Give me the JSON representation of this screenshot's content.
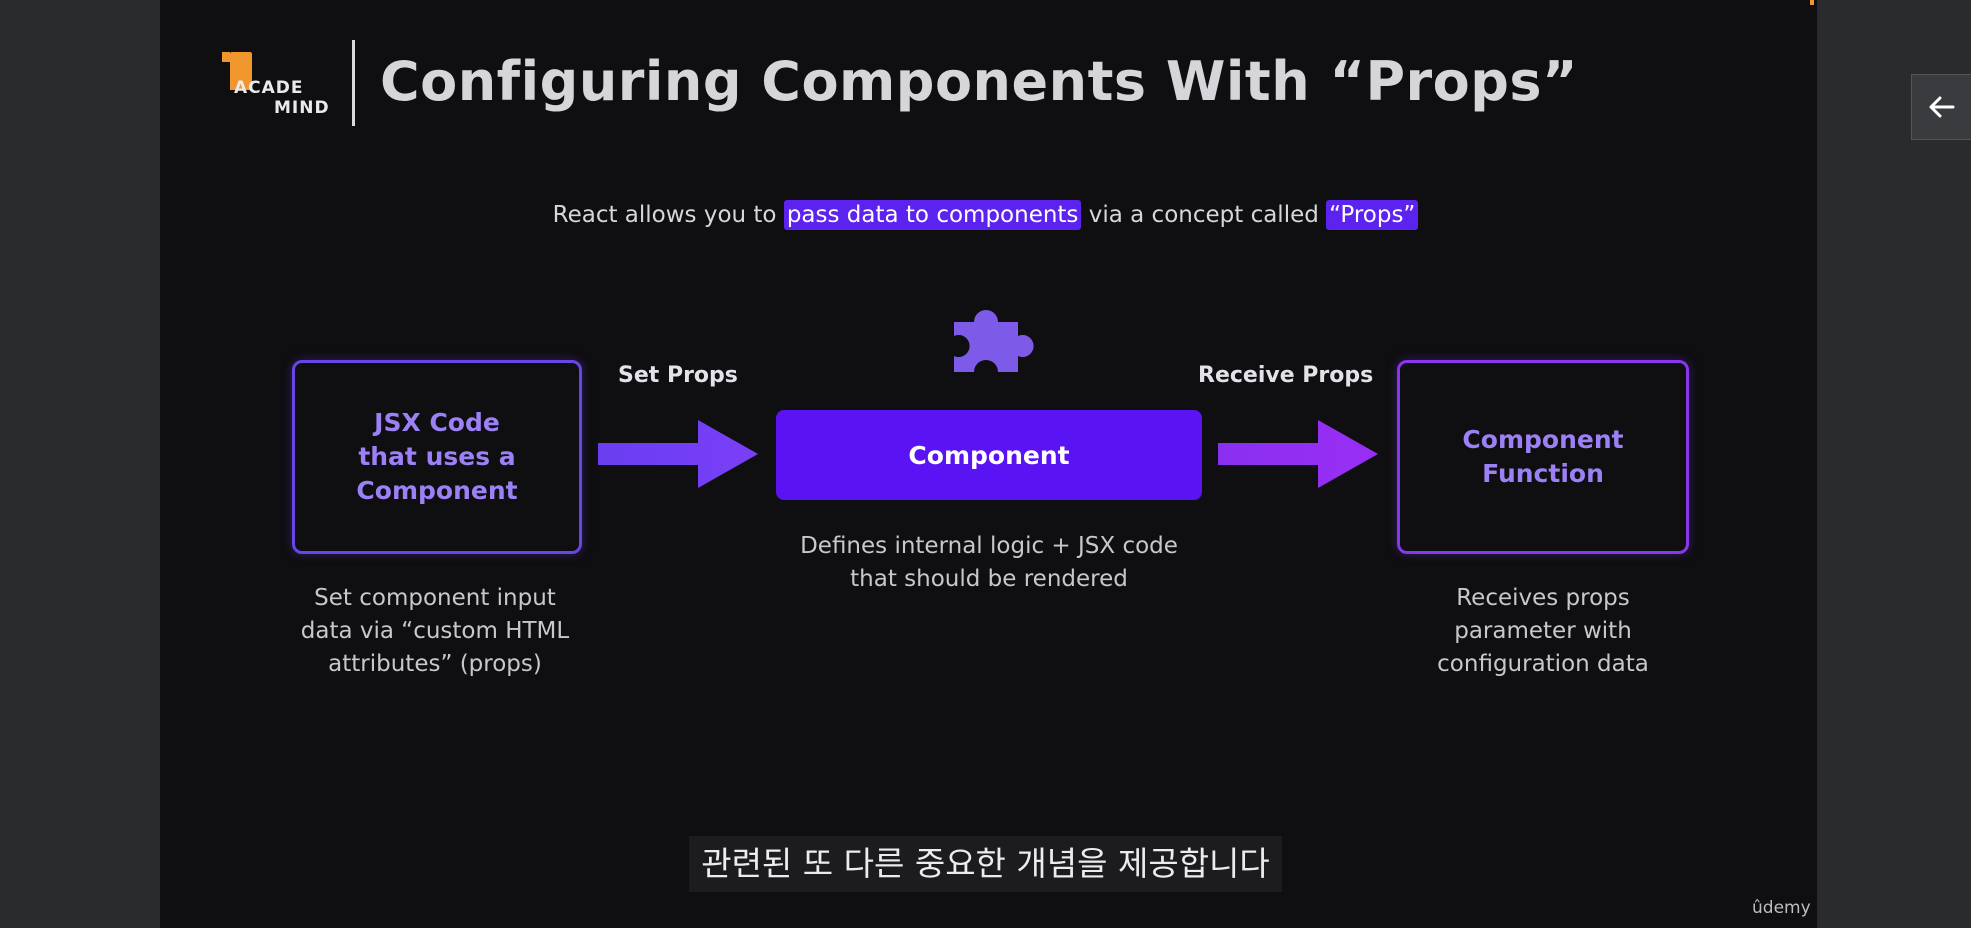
{
  "slide": {
    "logo": {
      "line1": "ACADE",
      "line2": "MIND"
    },
    "title": "Configuring Components With “Props”",
    "intro": {
      "part1": "React allows you to ",
      "highlight1": "pass data to components",
      "part2": " via a concept called ",
      "highlight2": "“Props”"
    },
    "diagram": {
      "left_box": {
        "line1": "JSX Code",
        "line2": "that uses a",
        "line3": "Component"
      },
      "arrow_left_label": "Set Props",
      "center_box": "Component",
      "arrow_right_label": "Receive Props",
      "right_box": {
        "line1": "Component",
        "line2": "Function"
      },
      "left_caption": {
        "line1": "Set component input",
        "line2": "data via “custom HTML",
        "line3": "attributes” (props)"
      },
      "center_caption": {
        "line1": "Defines internal logic + JSX code",
        "line2": "that should be rendered"
      },
      "right_caption": {
        "line1": "Receives props",
        "line2": "parameter with",
        "line3": "configuration data"
      }
    }
  },
  "subtitle": "관련된 또 다른 중요한 개념을 제공합니다",
  "brand": "ûdemy",
  "icons": {
    "puzzle": "puzzle-piece-icon",
    "back": "arrow-left-icon"
  },
  "colors": {
    "accent_purple": "#5a13f2",
    "outline_purple": "#6a45e6",
    "logo_orange": "#f0962c"
  }
}
